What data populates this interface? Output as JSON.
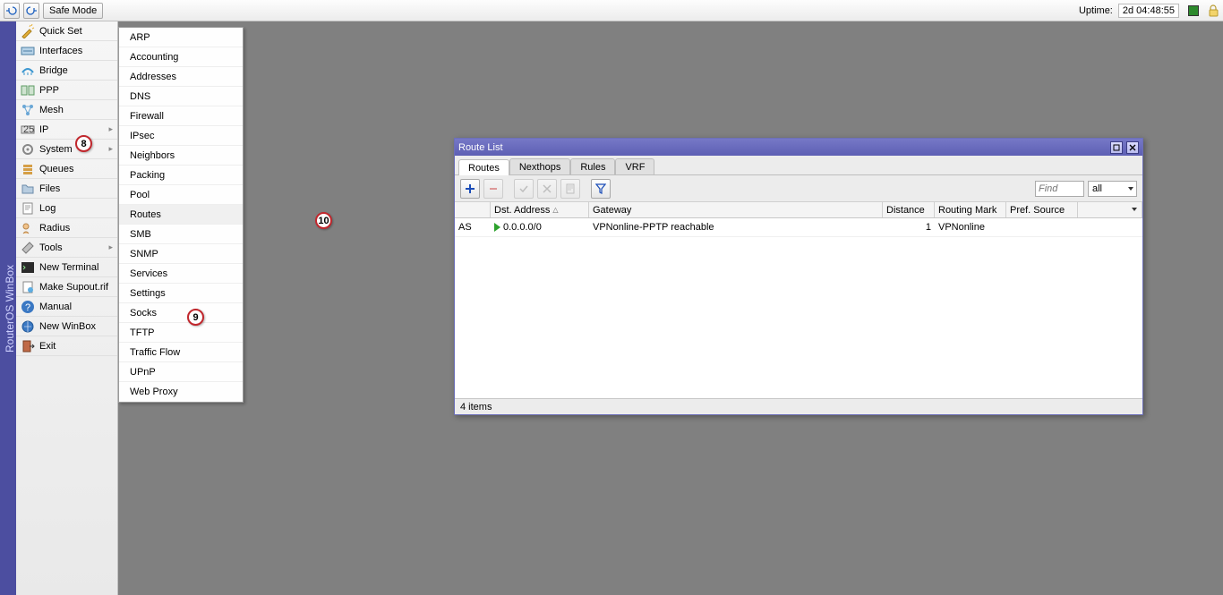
{
  "app_name": "RouterOS WinBox",
  "toolbar": {
    "safe_mode": "Safe Mode",
    "uptime_label": "Uptime:",
    "uptime_value": "2d 04:48:55"
  },
  "sidebar": {
    "items": [
      {
        "label": "Quick Set",
        "icon": "wand",
        "arrow": false
      },
      {
        "label": "Interfaces",
        "icon": "interfaces",
        "arrow": false
      },
      {
        "label": "Bridge",
        "icon": "bridge",
        "arrow": false
      },
      {
        "label": "PPP",
        "icon": "ppp",
        "arrow": false
      },
      {
        "label": "Mesh",
        "icon": "mesh",
        "arrow": false
      },
      {
        "label": "IP",
        "icon": "ip",
        "arrow": true
      },
      {
        "label": "System",
        "icon": "system",
        "arrow": true
      },
      {
        "label": "Queues",
        "icon": "queues",
        "arrow": false
      },
      {
        "label": "Files",
        "icon": "files",
        "arrow": false
      },
      {
        "label": "Log",
        "icon": "log",
        "arrow": false
      },
      {
        "label": "Radius",
        "icon": "radius",
        "arrow": false
      },
      {
        "label": "Tools",
        "icon": "tools",
        "arrow": true
      },
      {
        "label": "New Terminal",
        "icon": "terminal",
        "arrow": false
      },
      {
        "label": "Make Supout.rif",
        "icon": "supout",
        "arrow": false
      },
      {
        "label": "Manual",
        "icon": "manual",
        "arrow": false
      },
      {
        "label": "New WinBox",
        "icon": "winbox",
        "arrow": false
      },
      {
        "label": "Exit",
        "icon": "exit",
        "arrow": false
      }
    ]
  },
  "submenu": {
    "items": [
      "ARP",
      "Accounting",
      "Addresses",
      "DNS",
      "Firewall",
      "IPsec",
      "Neighbors",
      "Packing",
      "Pool",
      "Routes",
      "SMB",
      "SNMP",
      "Services",
      "Settings",
      "Socks",
      "TFTP",
      "Traffic Flow",
      "UPnP",
      "Web Proxy"
    ]
  },
  "window": {
    "title": "Route List",
    "tabs": [
      "Routes",
      "Nexthops",
      "Rules",
      "VRF"
    ],
    "active_tab": 0,
    "find_placeholder": "Find",
    "filter_value": "all",
    "columns": {
      "flags": "",
      "dst": "Dst. Address",
      "gw": "Gateway",
      "dist": "Distance",
      "rm": "Routing Mark",
      "ps": "Pref. Source"
    },
    "rows": [
      {
        "flags": "AS",
        "dst": "0.0.0.0/0",
        "gw": "VPNonline-PPTP reachable",
        "dist": "1",
        "rm": "VPNonline",
        "ps": ""
      }
    ],
    "status": "4 items"
  },
  "annotations": {
    "a8": "8",
    "a9": "9",
    "a10": "10"
  }
}
